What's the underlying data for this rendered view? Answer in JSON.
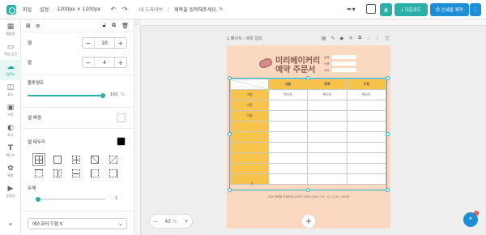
{
  "topbar": {
    "menu_file": "파일",
    "menu_settings": "설정",
    "canvas_size": "1200px ⨯ 1200px",
    "breadcrumb_root": "내 드라이브",
    "breadcrumb_sep": "/",
    "doc_title": "제목을 입력해주세요.",
    "download_label": "다운로드",
    "print_label": "인쇄물 제작"
  },
  "rail": {
    "items": [
      {
        "label": "템플릿",
        "icon": "template-icon"
      },
      {
        "label": "작업 공간",
        "icon": "workspace-icon"
      },
      {
        "label": "업로드",
        "icon": "upload-icon"
      },
      {
        "label": "요소",
        "icon": "elements-icon"
      },
      {
        "label": "사진",
        "icon": "photo-icon"
      },
      {
        "label": "도식",
        "icon": "diagram-icon"
      },
      {
        "label": "텍스트",
        "icon": "text-icon"
      },
      {
        "label": "배경",
        "icon": "background-icon"
      },
      {
        "label": "동영상",
        "icon": "video-icon"
      }
    ]
  },
  "panel": {
    "rows_label": "행",
    "rows_value": "10",
    "cols_label": "열",
    "cols_value": "4",
    "opacity_label": "불투명도",
    "opacity_value": "100",
    "opacity_unit": "%",
    "opacity_fraction": 1.0,
    "cell_bg_label": "셀 배경",
    "cell_border_label": "셀 테두리",
    "border_color": "#000000",
    "thickness_label": "두께",
    "thickness_value": "1",
    "font_value": "에스코어 드림 5"
  },
  "page": {
    "header": "1 페이지 - 제목 입력",
    "title_line1": "미리베이커리",
    "title_line2": "예약 주문서",
    "info_labels": [
      "날짜",
      "이름",
      "연락"
    ],
    "table_headers": [
      "",
      "내용",
      "항목",
      "수량"
    ],
    "table_row1": [
      "이름",
      "텍스트",
      "텍스트",
      "텍스트"
    ],
    "table_rows_left": [
      "이름",
      "이름",
      "",
      "",
      "",
      "",
      "",
      ""
    ],
    "footer": "도로 연락할 전화번호 000번 0000-0000 주소 · 00 1234 - 5678"
  },
  "zoom": {
    "value": "43",
    "unit": "%"
  },
  "help_badge": "1"
}
